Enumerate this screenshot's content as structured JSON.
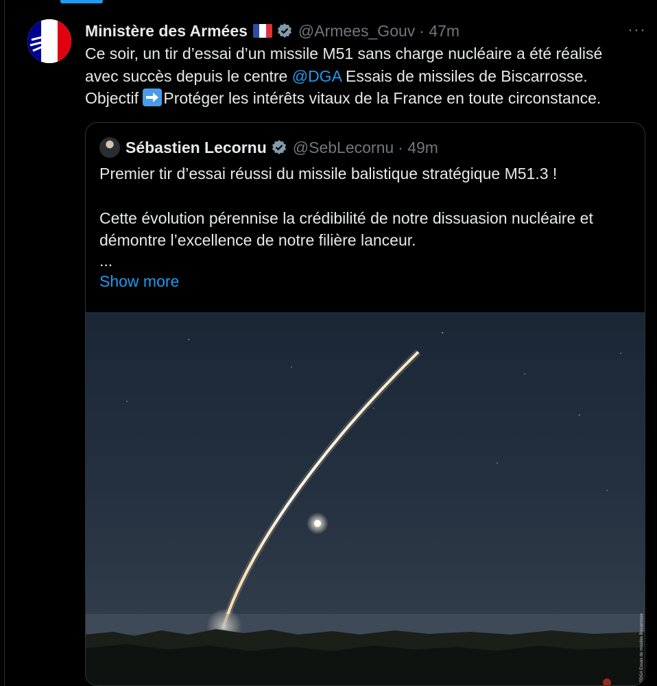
{
  "tweet": {
    "author_name": "Ministère des Armées",
    "handle": "@Armees_Gouv",
    "time": "· 47m",
    "more_label": "···",
    "text_line1": "Ce soir, un tir d’essai d’un missile M51 sans charge nucléaire a été réalisé",
    "text_line2_pre": "avec succès depuis le centre ",
    "mention": "@DGA",
    "text_line2_post": " Essais de missiles de Biscarrosse.",
    "text_line3_pre": "Objectif ",
    "text_line3_post": "Protéger les intérêts vitaux de la France en toute circonstance."
  },
  "quote": {
    "author_name": "Sébastien Lecornu",
    "handle": "@SebLecornu",
    "time": "· 49m",
    "line1": "Premier tir d’essai réussi du missile balistique stratégique M51.3 !",
    "line2": "Cette évolution pérennise la crédibilité de notre dissuasion nucléaire et",
    "line3": "démontre l’excellence de notre filière lanceur.",
    "ellipsis": "...",
    "show_more": "Show more",
    "photo_credit": "©DGA Essais de missiles Biscarrosse"
  },
  "colors": {
    "accent": "#1d9bf0",
    "muted": "#71767b",
    "background": "#000000",
    "border": "#2f3336"
  },
  "icons": [
    "flag-france-icon",
    "verified-badge-icon",
    "more-options-icon",
    "right-arrow-emoji-icon",
    "marianne-logo-icon"
  ]
}
